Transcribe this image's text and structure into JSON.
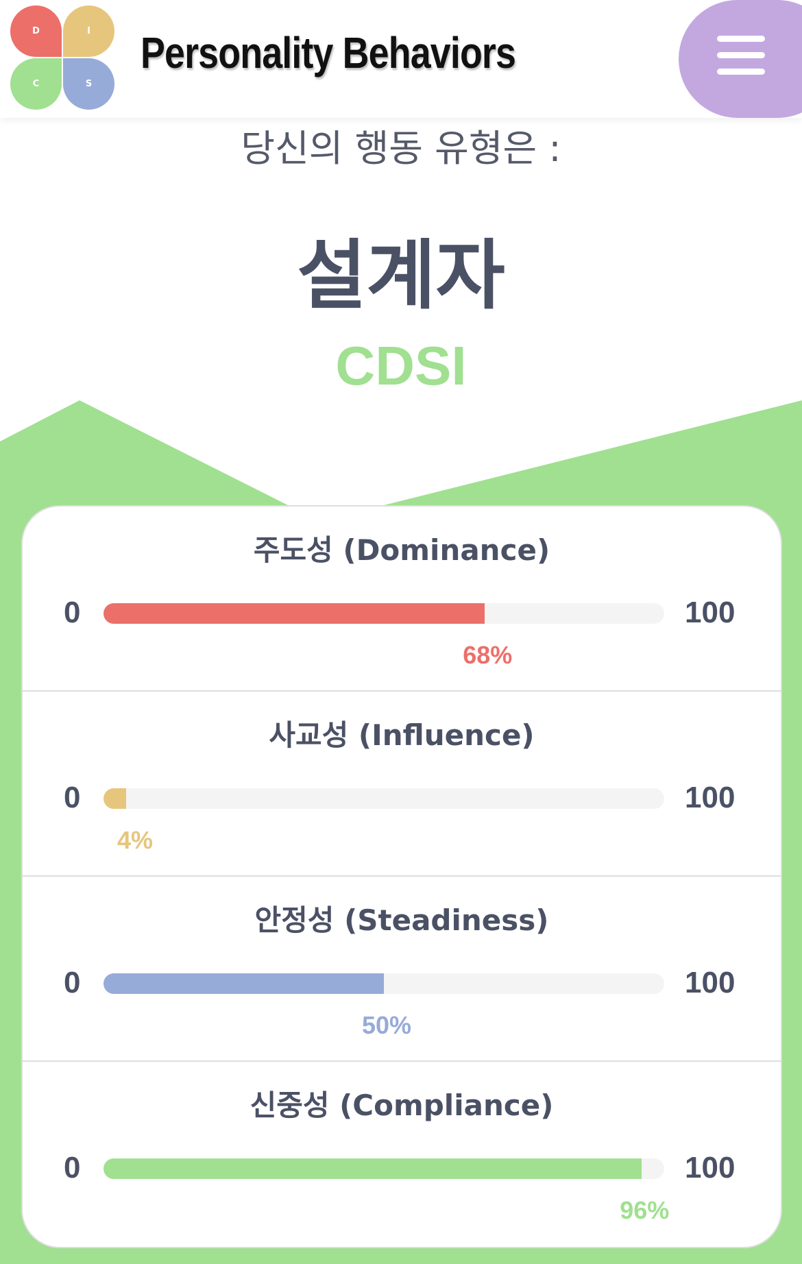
{
  "header": {
    "title": "Personality Behaviors",
    "logo_letters": [
      "D",
      "I",
      "C",
      "S"
    ],
    "menu_icon": "hamburger-menu-icon"
  },
  "result": {
    "subtitle": "당신의 행동 유형은 :",
    "type_name": "설계자",
    "type_code": "CDSI"
  },
  "colors": {
    "dominance": "#ed6f69",
    "influence": "#e6c67d",
    "steadiness": "#97abd8",
    "compliance": "#a0e090",
    "menu": "#c3a8e0",
    "accent_green": "#a0e090"
  },
  "metrics": [
    {
      "label": "주도성 (Dominance)",
      "min": "0",
      "max": "100",
      "value": 68,
      "percent_label": "68%",
      "color": "#ed6f69"
    },
    {
      "label": "사교성 (Influence)",
      "min": "0",
      "max": "100",
      "value": 4,
      "percent_label": "4%",
      "color": "#e6c67d"
    },
    {
      "label": "안정성 (Steadiness)",
      "min": "0",
      "max": "100",
      "value": 50,
      "percent_label": "50%",
      "color": "#97abd8"
    },
    {
      "label": "신중성 (Compliance)",
      "min": "0",
      "max": "100",
      "value": 96,
      "percent_label": "96%",
      "color": "#a0e090"
    }
  ]
}
